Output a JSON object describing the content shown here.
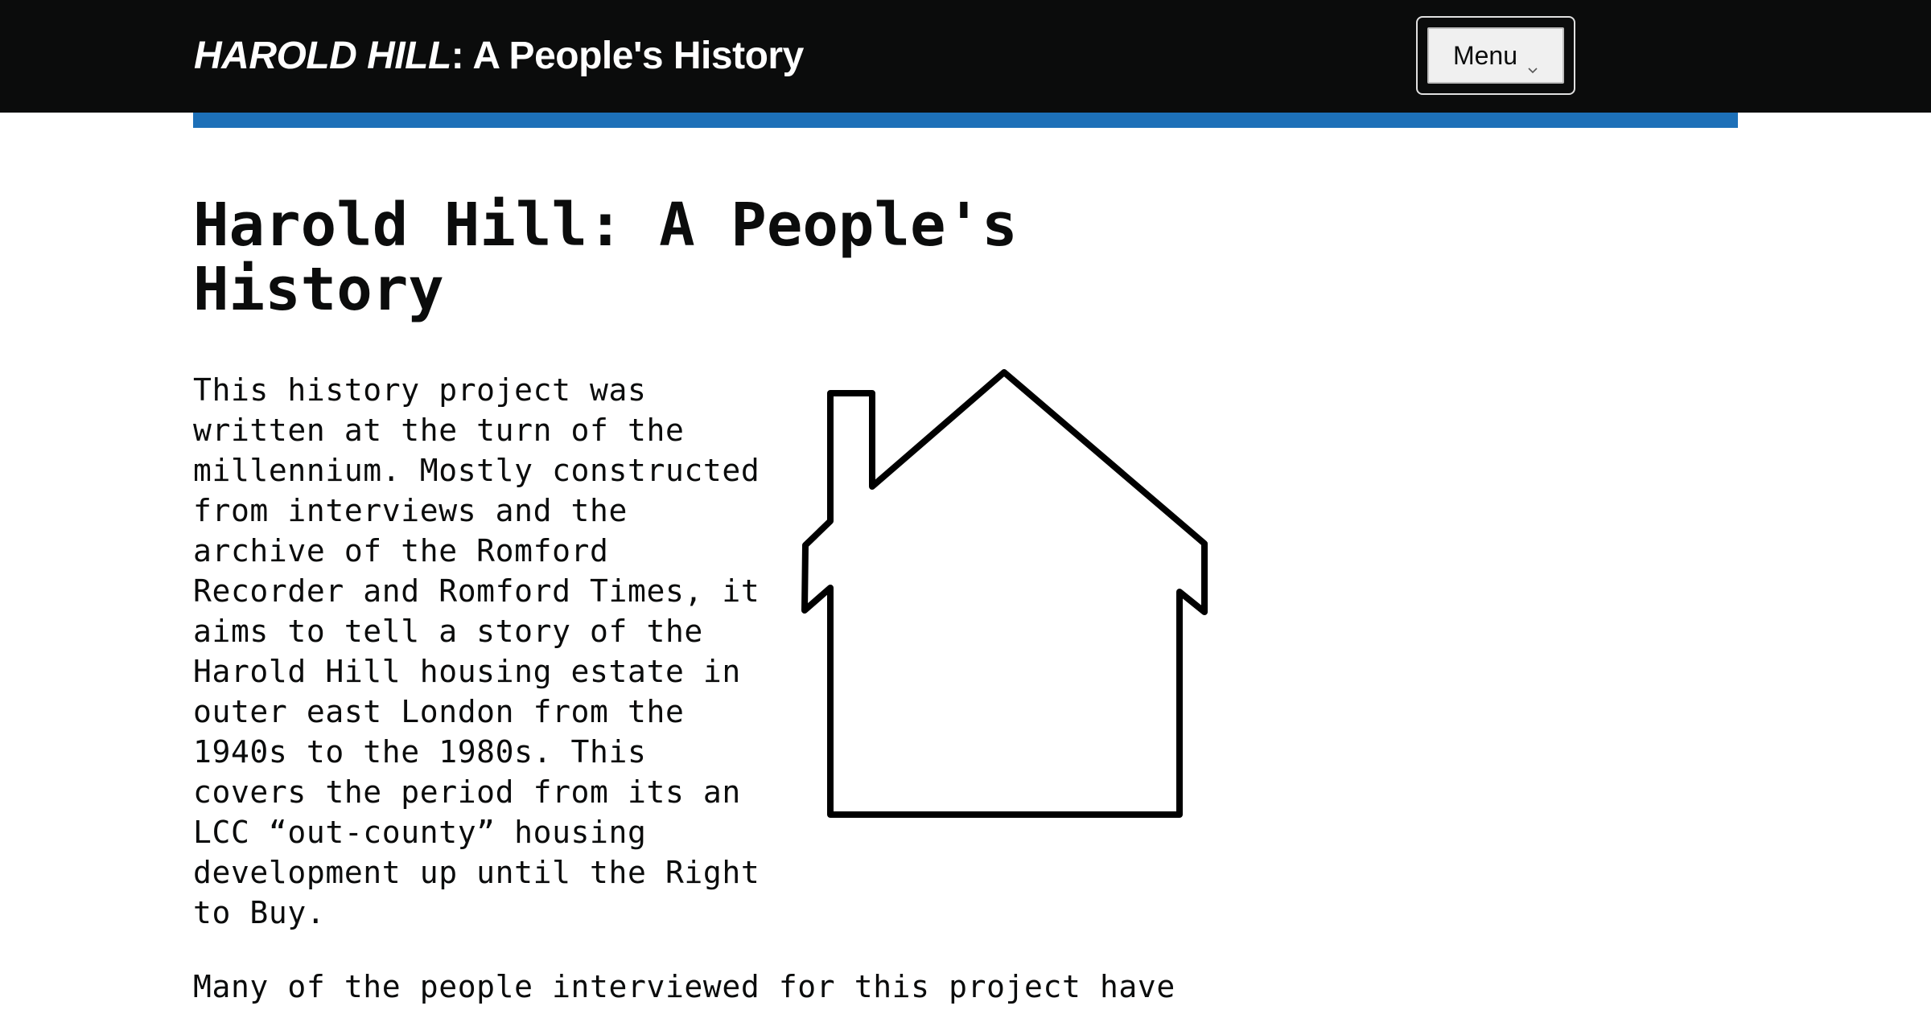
{
  "header": {
    "site_title_emphasis": "HAROLD HILL",
    "site_title_rest": ": A People's History",
    "menu_label": "Menu"
  },
  "colors": {
    "header_background": "#0b0c0c",
    "accent_bar": "#1d70b8",
    "text": "#0b0c0c"
  },
  "main": {
    "title": "Harold Hill: A People's History",
    "intro": "This history project was\nwritten at the turn of the\nmillennium. Mostly constructed\nfrom interviews and the\narchive of the Romford\nRecorder and Romford Times, it\naims to tell a story of the\nHarold Hill housing estate in\nouter east London from the\n1940s to the 1980s. This\ncovers the period from its an\nLCC “out-county” housing\ndevelopment up until the Right\nto Buy.",
    "second_paragraph": "Many of the people interviewed for this project have"
  },
  "icons": {
    "house": "house-outline-icon",
    "menu_chevron": "chevron-down-icon"
  }
}
